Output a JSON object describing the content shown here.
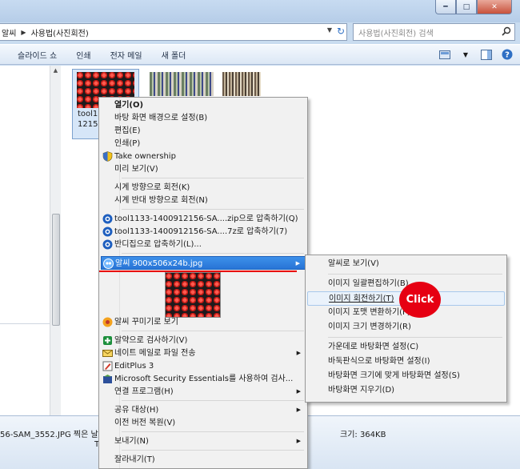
{
  "window": {
    "min_glyph": "━",
    "max_glyph": "□",
    "close_glyph": "✕"
  },
  "address": {
    "crumbs": [
      "알씨",
      "사용법(사진회전)"
    ],
    "search_placeholder": "사용법(사진회전) 검색"
  },
  "toolbar": {
    "items": [
      "슬라이드 쇼",
      "인쇄",
      "전자 메일",
      "새 폴더"
    ]
  },
  "file_tile": {
    "name_line1": "tool11",
    "name_line2": "12156"
  },
  "context_menu": {
    "open": "열기(O)",
    "set_background": "바탕 화면 배경으로 설정(B)",
    "edit": "편집(E)",
    "print": "인쇄(P)",
    "take_ownership": "Take ownership",
    "preview": "미리 보기(V)",
    "rotate_cw": "시계 방향으로 회전(K)",
    "rotate_ccw": "시계 반대 방향으로 회전(N)",
    "zip": "tool1133-1400912156-SA....zip으로 압축하기(Q)",
    "sevenz": "tool1133-1400912156-SA....7z로 압축하기(7)",
    "bandizip": "반디집으로 압축하기(L)...",
    "alsee_item": "알씨 900x506x24b.jpg",
    "alsee_decorate": "알씨 꾸미기로 보기",
    "alyac_scan": "알약으로 검사하기(V)",
    "nate_mail": "네이트 메일로 파일 전송",
    "editplus": "EditPlus 3",
    "mse_scan": "Microsoft Security Essentials를 사용하여 검사...",
    "open_with": "연결 프로그램(H)",
    "share": "공유 대상(H)",
    "restore": "이전 버전 복원(V)",
    "send_to": "보내기(N)",
    "cut": "잘라내기(T)"
  },
  "submenu": {
    "view": "알씨로 보기(V)",
    "batch_edit": "이미지 일괄편집하기(B)",
    "rotate": "이미지 회전하기(T)",
    "convert": "이미지 포맷 변환하기(F)",
    "resize": "이미지 크기 변경하기(R)",
    "wall_center": "가운데로 바탕화면 설정(C)",
    "wall_tile": "바둑판식으로 바탕화면 설정(I)",
    "wall_fit": "바탕화면 크기에 맞게 바탕화면 설정(S)",
    "wall_clear": "바탕화면 지우기(D)"
  },
  "annotation": {
    "click_label": "Click",
    "color": "#e60012"
  },
  "details": {
    "filename": "56-SAM_3552.JPG  찍은 날",
    "size": "크기: 364KB",
    "row2": "T"
  },
  "colors": {
    "menu_highlight": "#2874d6",
    "hover": "#eaf2fb"
  }
}
